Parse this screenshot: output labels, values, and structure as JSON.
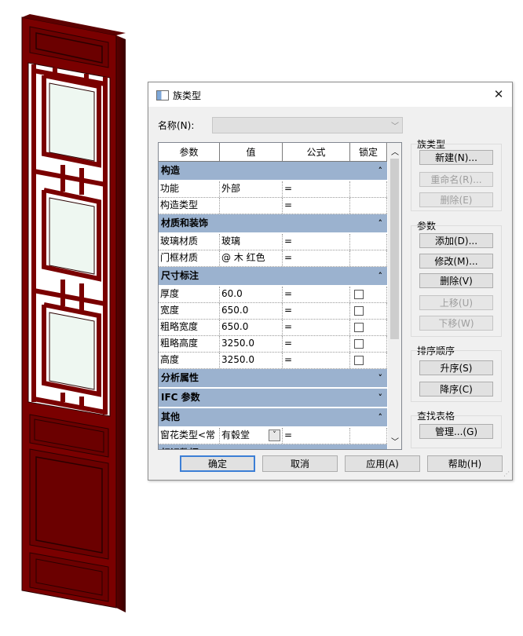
{
  "dialog": {
    "title": "族类型",
    "close_glyph": "✕",
    "name_label": "名称(N):",
    "name_value": ""
  },
  "grid": {
    "headers": [
      "参数",
      "值",
      "公式",
      "锁定"
    ],
    "groups": [
      {
        "label": "构造",
        "collapsed": false,
        "rows": [
          {
            "param": "功能",
            "value": "外部",
            "formula": "=",
            "lock": false,
            "show_lock": false
          },
          {
            "param": "构造类型",
            "value": "",
            "formula": "=",
            "lock": false,
            "show_lock": false
          }
        ]
      },
      {
        "label": "材质和装饰",
        "collapsed": false,
        "rows": [
          {
            "param": "玻璃材质",
            "value": "玻璃",
            "formula": "=",
            "lock": false,
            "show_lock": false
          },
          {
            "param": "门框材质",
            "value": "@ 木 红色",
            "formula": "=",
            "lock": false,
            "show_lock": false
          }
        ]
      },
      {
        "label": "尺寸标注",
        "collapsed": false,
        "rows": [
          {
            "param": "厚度",
            "value": "60.0",
            "formula": "=",
            "lock": false,
            "show_lock": true
          },
          {
            "param": "宽度",
            "value": "650.0",
            "formula": "=",
            "lock": false,
            "show_lock": true
          },
          {
            "param": "粗略宽度",
            "value": "650.0",
            "formula": "=",
            "lock": false,
            "show_lock": true
          },
          {
            "param": "粗略高度",
            "value": "3250.0",
            "formula": "=",
            "lock": false,
            "show_lock": true
          },
          {
            "param": "高度",
            "value": "3250.0",
            "formula": "=",
            "lock": false,
            "show_lock": true
          }
        ]
      },
      {
        "label": "分析属性",
        "collapsed": true,
        "rows": []
      },
      {
        "label": "IFC 参数",
        "collapsed": true,
        "rows": []
      },
      {
        "label": "其他",
        "collapsed": false,
        "rows": [
          {
            "param": "窗花类型<常",
            "value": "有毂堂",
            "formula": "=",
            "lock": false,
            "show_lock": false,
            "combo": true
          }
        ]
      },
      {
        "label": "标识数据",
        "collapsed": false,
        "rows": []
      }
    ]
  },
  "right": {
    "family_types_label": "族类型",
    "new_btn": "新建(N)...",
    "rename_btn": "重命名(R)...",
    "delete_type_btn": "删除(E)",
    "params_label": "参数",
    "add_btn": "添加(D)...",
    "modify_btn": "修改(M)...",
    "delete_param_btn": "删除(V)",
    "move_up_btn": "上移(U)",
    "move_down_btn": "下移(W)",
    "sort_label": "排序顺序",
    "asc_btn": "升序(S)",
    "desc_btn": "降序(C)",
    "lookup_label": "查找表格",
    "manage_btn": "管理...(G)"
  },
  "bottom": {
    "ok": "确定",
    "cancel": "取消",
    "apply": "应用(A)",
    "help": "帮助(H)"
  },
  "colors": {
    "door_red": "#7a0000",
    "glass": "#eef7f1",
    "group_header": "#9bb2cf",
    "default_button_border": "#3c7fd6"
  }
}
